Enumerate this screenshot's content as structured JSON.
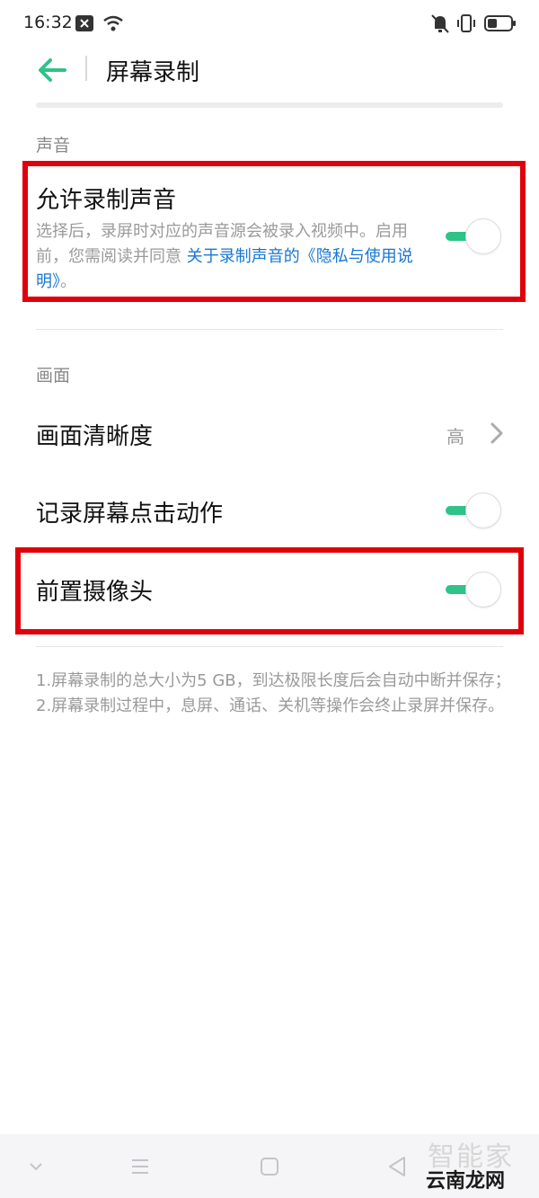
{
  "status": {
    "time": "16:32"
  },
  "header": {
    "title": "屏幕录制"
  },
  "sections": {
    "audio": {
      "label": "声音",
      "allow_record_audio": {
        "title": "允许录制声音",
        "description": "选择后，录屏时对应的声音源会被录入视频中。启用前，您需阅读并同意 ",
        "link_text": "关于录制声音的《隐私与使用说明》",
        "tail": "。",
        "enabled": true
      }
    },
    "video": {
      "label": "画面",
      "clarity": {
        "title": "画面清晰度",
        "value": "高"
      },
      "record_taps": {
        "title": "记录屏幕点击动作",
        "enabled": true
      },
      "front_camera": {
        "title": "前置摄像头",
        "enabled": true
      }
    }
  },
  "notes": {
    "line1": "1.屏幕录制的总大小为5 GB，到达极限长度后会自动中断并保存；",
    "line2": "2.屏幕录制过程中，息屏、通话、关机等操作会终止录屏并保存。"
  },
  "colors": {
    "accent": "#2fc386",
    "link": "#1976d2",
    "highlight": "#e0000b"
  },
  "watermark": {
    "text": "云南龙网",
    "faint": "智能家"
  }
}
